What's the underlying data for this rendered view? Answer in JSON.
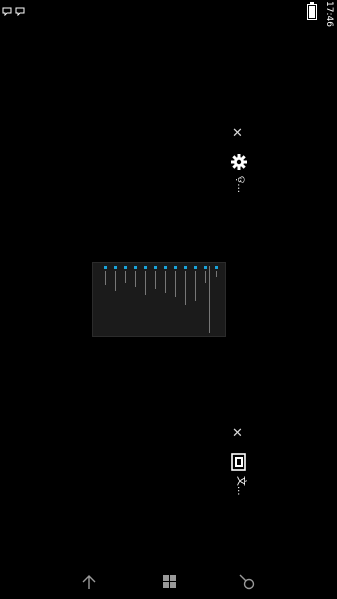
{
  "status_bar": {
    "time": "17:46",
    "icons": [
      "notification-icon",
      "notification-icon",
      "battery-icon"
    ]
  },
  "task_switcher": {
    "cards": [
      {
        "app_name": "ଡ଼...",
        "icon": "gear-icon",
        "close_symbol": "✕"
      },
      {
        "app_name": "文...",
        "icon": "file-icon",
        "close_symbol": "✕"
      }
    ]
  },
  "nav_bar": {
    "buttons": [
      "back-arrow-icon",
      "start-windows-icon",
      "search-icon"
    ]
  },
  "colors": {
    "background": "#000000",
    "accent": "#19a3d9"
  }
}
